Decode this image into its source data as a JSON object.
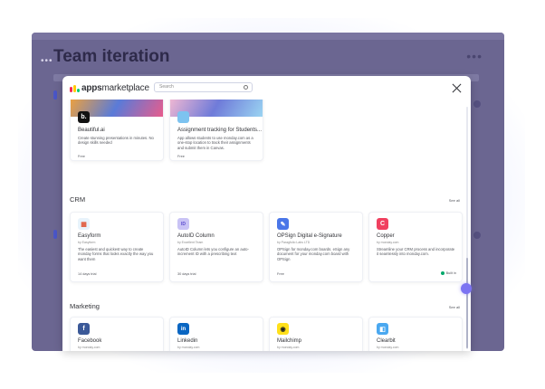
{
  "background": {
    "board_title": "Team iteration",
    "more_label": "•••",
    "dots_label": "•••"
  },
  "modal": {
    "logo": {
      "brand_bold": "apps",
      "brand_rest": "marketplace",
      "mark_colors": [
        "#f62b54",
        "#ffcb00",
        "#00ca72"
      ]
    },
    "search": {
      "placeholder": "Search"
    },
    "close_icon": "close-icon"
  },
  "top_cards": [
    {
      "name": "Beautiful.ai",
      "description": "Create stunning presentations in minutes. No design skills needed",
      "tag": "Free",
      "icon_color": "#111111",
      "icon_glyph": "b.",
      "banner_colors": [
        "#f2a23a",
        "#5a7bd8",
        "#e85c8c"
      ]
    },
    {
      "name": "Assignment tracking for Students...",
      "description": "App allows students to use monday.com as a one-stop location to track their assignments and submit them in Canvas.",
      "tag": "Free",
      "icon_color": "#7dc3f0",
      "icon_glyph": "",
      "banner_colors": [
        "#f4b9d2",
        "#6f7bd9",
        "#9ad4f2"
      ]
    }
  ],
  "sections": [
    {
      "title": "CRM",
      "see_all": "See all",
      "cards": [
        {
          "name": "Easyform",
          "by": "by Easyform",
          "description": "The easiest and quickest way to create monday forms that looks exactly the way you want them",
          "tag": "14 days trial",
          "icon_color": "#e8f3fb",
          "icon_glyph": "▦",
          "glyph_color": "#e0583a"
        },
        {
          "name": "AutoID Column",
          "by": "by Excellent Team",
          "description": "AutoID Column lets you configure an auto-increment ID with a prescribing text",
          "tag": "30 days trial",
          "icon_color": "#c9c3f5",
          "icon_glyph": "ID",
          "glyph_color": "#5b4ccf"
        },
        {
          "name": "OPSign Digital e-Signature",
          "by": "by Paragfolio Labs LTD",
          "description": "OPSign for monday.com boards. eSign any document for your monday.com board with OPSign",
          "tag": "Free",
          "icon_color": "#4a76e8",
          "icon_glyph": "✎",
          "glyph_color": "#ffffff"
        },
        {
          "name": "Copper",
          "by": "by monday.com",
          "description": "Streamline your CRM process and incorporate it seamlessly into monday.com.",
          "tag": "",
          "built_in": "Built in",
          "icon_color": "#f0405f",
          "icon_glyph": "C",
          "glyph_color": "#ffffff"
        }
      ]
    },
    {
      "title": "Marketing",
      "see_all": "See all",
      "cards": [
        {
          "name": "Facebook",
          "by": "by monday.com",
          "icon_color": "#3b5998",
          "icon_glyph": "f",
          "glyph_color": "#ffffff"
        },
        {
          "name": "Linkedin",
          "by": "by monday.com",
          "icon_color": "#0a66c2",
          "icon_glyph": "in",
          "glyph_color": "#ffffff"
        },
        {
          "name": "Mailchimp",
          "by": "by monday.com",
          "icon_color": "#ffe01b",
          "icon_glyph": "◉",
          "glyph_color": "#222222"
        },
        {
          "name": "Clearbit",
          "by": "by monday.com",
          "icon_color": "#4aa8f0",
          "icon_glyph": "◧",
          "glyph_color": "#ffffff"
        }
      ]
    }
  ]
}
